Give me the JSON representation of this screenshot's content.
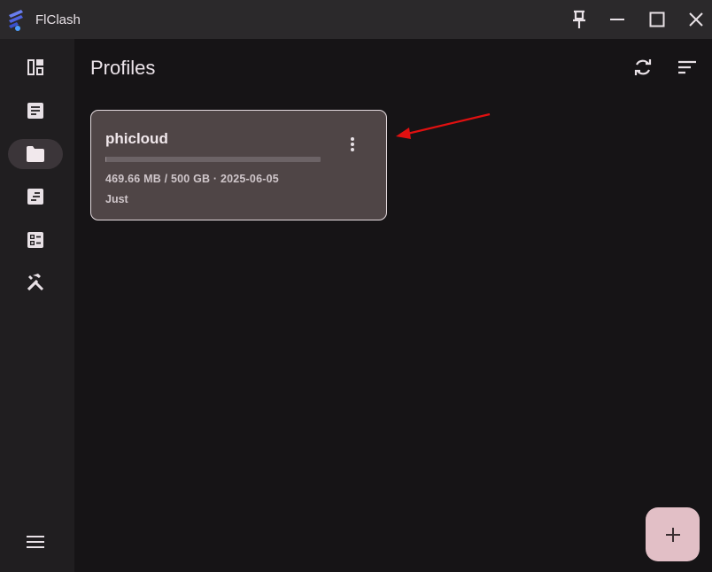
{
  "app": {
    "title": "FlClash"
  },
  "window_controls": [
    "pin-icon",
    "minimize-icon",
    "maximize-icon",
    "close-icon"
  ],
  "sidebar": {
    "items": [
      {
        "id": "dashboard",
        "icon": "dashboard-icon",
        "active": false
      },
      {
        "id": "proxies",
        "icon": "article-icon",
        "active": false
      },
      {
        "id": "profiles",
        "icon": "folder-icon",
        "active": true
      },
      {
        "id": "requests",
        "icon": "list-doc-icon",
        "active": false
      },
      {
        "id": "resources",
        "icon": "checklist-icon",
        "active": false
      },
      {
        "id": "tools",
        "icon": "tools-icon",
        "active": false
      }
    ],
    "menu_icon": "menu-icon"
  },
  "page": {
    "title": "Profiles"
  },
  "profiles": [
    {
      "name": "phicloud",
      "usage_fraction": 0.0009,
      "usage_text": "469.66 MB / 500 GB · 2025-06-05",
      "updated": "Just"
    }
  ],
  "colors": {
    "accent": "#e2bfc6",
    "annotation_arrow": "#e01010",
    "card_bg": "#4f4546"
  }
}
